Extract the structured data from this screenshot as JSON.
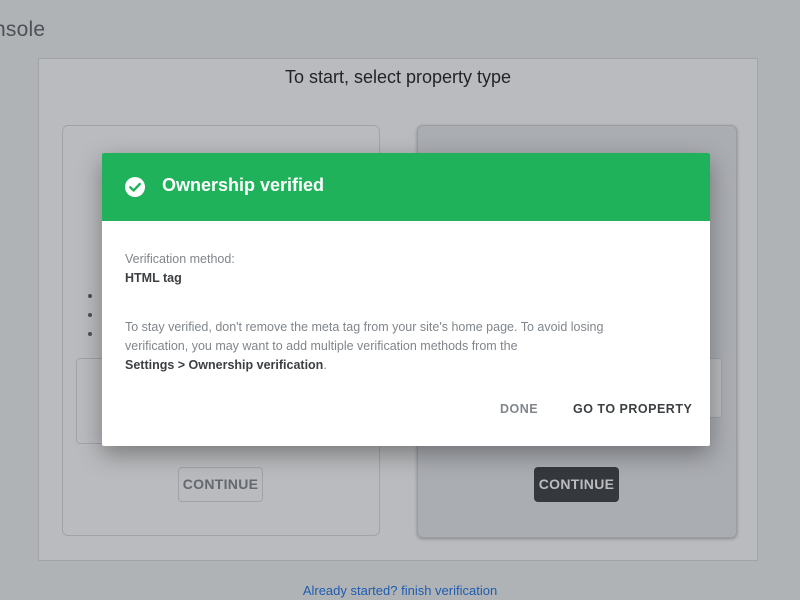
{
  "app": {
    "title_fragment": "nsole"
  },
  "background": {
    "heading": "To start, select property type",
    "left_card": {
      "continue_label": "CONTINUE"
    },
    "right_card": {
      "continue_label": "CONTINUE"
    },
    "footer_link": "Already started? finish verification"
  },
  "dialog": {
    "title": "Ownership verified",
    "icon": "check-circle-icon",
    "method_label": "Verification method:",
    "method_value": "HTML tag",
    "info_text": "To stay verified, don't remove the meta tag from your site's home page. To avoid losing verification, you may want to add multiple verification methods from the",
    "info_settings_path": "Settings > Ownership verification",
    "info_suffix": ".",
    "done_label": "DONE",
    "go_to_property_label": "GO TO PROPERTY",
    "header_color": "#1fb25a"
  }
}
